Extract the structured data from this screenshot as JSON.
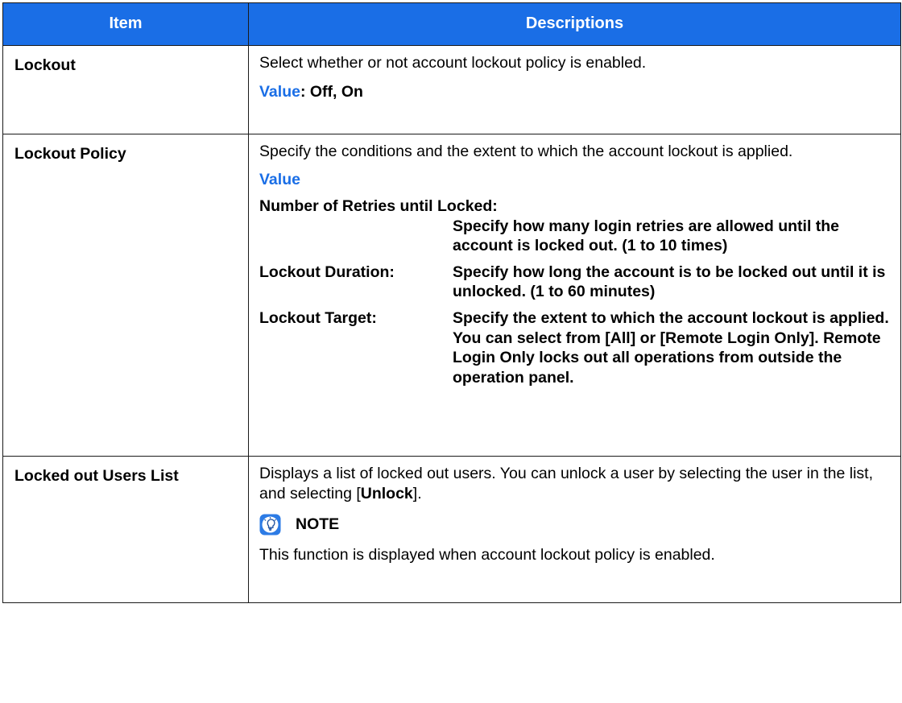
{
  "table": {
    "headers": {
      "item": "Item",
      "descriptions": "Descriptions"
    },
    "rows": {
      "lockout": {
        "item": "Lockout",
        "desc": "Select whether or not account lockout policy is enabled.",
        "value_label": "Value",
        "value_text": ": Off, On"
      },
      "lockout_policy": {
        "item": "Lockout Policy",
        "desc": "Specify the conditions and the extent to which the account lockout is applied.",
        "value_heading": "Value",
        "retries_label": "Number of Retries until Locked:",
        "retries_desc": "Specify how many login retries are allowed until the account is locked out. (1 to 10 times)",
        "duration_label": "Lockout Duration:",
        "duration_desc": "Specify how long the account is to be locked out until it is unlocked. (1 to 60 minutes)",
        "target_label": "Lockout Target:",
        "target_desc": "Specify the extent to which the account lockout is applied. You can select from [All] or [Remote Login Only]. Remote Login Only locks out all operations from outside the operation panel."
      },
      "locked_users": {
        "item": "Locked out Users List",
        "desc_before": "Displays a list of locked out users. You can unlock a user by selecting the user in the list, and selecting [",
        "desc_bold": "Unlock",
        "desc_after": "].",
        "note_title": "NOTE",
        "note_text": "This function is displayed when account lockout policy is enabled.",
        "note_icon": "note-lightbulb-icon"
      }
    }
  },
  "colors": {
    "header_bg": "#1a6ee6",
    "header_text": "#ffffff",
    "value_label": "#1a6ee6"
  }
}
